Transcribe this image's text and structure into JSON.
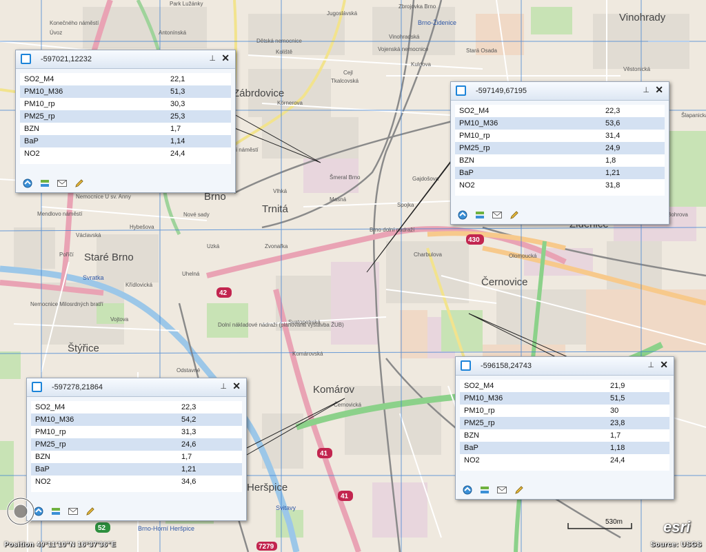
{
  "map": {
    "districts": [
      "Vinohrady",
      "Brno",
      "Trnitá",
      "Staré Brno",
      "Černovice",
      "Štýřice",
      "Komárov",
      "Heršpice",
      "Zábrdovice",
      "Židenice"
    ],
    "streets": [
      "Zbrojovka Brno",
      "Brno-Židenice",
      "Jugoslávská",
      "Dětská nemocnice",
      "Vojenská nemocnice",
      "Koliště",
      "Nemocnice U sv. Anny",
      "Mendlovo náměstí",
      "Hybešova",
      "Václavská",
      "Poříčí",
      "Křídlovická",
      "Nemocnice Milosrdných bratří",
      "Vojtova",
      "Úvoz",
      "Konečného náměstí",
      "Antonínská",
      "Park Lužánky",
      "Cejl",
      "Tkalcovská",
      "Körnerova",
      "Vlhká",
      "Masná",
      "Zvonařka",
      "Uzká",
      "Nové sady",
      "Uhelná",
      "Dolní nákladové nádraží (plánovaná výstavba ŽUB)",
      "Svatopetrská",
      "Komárovská",
      "Odstavné",
      "Černovická",
      "Charbulova",
      "Olomoucká",
      "Svratka",
      "Gajdošova",
      "Stará Osada",
      "Kuldova",
      "Vinohradská",
      "Věstonická",
      "Svitavy",
      "Brno-Horní Heršpice",
      "Bohrova",
      "Šlapanicka",
      "Spojka",
      "Brno dolní nádraží",
      "Šmeral Brno",
      "Sklámi náměstí"
    ],
    "shields": [
      "42",
      "430",
      "41",
      "41",
      "52",
      "7279"
    ]
  },
  "popups": [
    {
      "title": "-597021,12232",
      "rows": [
        {
          "key": "SO2_M4",
          "value": "22,1"
        },
        {
          "key": "PM10_M36",
          "value": "51,3"
        },
        {
          "key": "PM10_rp",
          "value": "30,3"
        },
        {
          "key": "PM25_rp",
          "value": "25,3"
        },
        {
          "key": "BZN",
          "value": "1,7"
        },
        {
          "key": "BaP",
          "value": "1,14"
        },
        {
          "key": "NO2",
          "value": "24,4"
        }
      ]
    },
    {
      "title": "-597149,67195",
      "rows": [
        {
          "key": "SO2_M4",
          "value": "22,3"
        },
        {
          "key": "PM10_M36",
          "value": "53,6"
        },
        {
          "key": "PM10_rp",
          "value": "31,4"
        },
        {
          "key": "PM25_rp",
          "value": "24,9"
        },
        {
          "key": "BZN",
          "value": "1,8"
        },
        {
          "key": "BaP",
          "value": "1,21"
        },
        {
          "key": "NO2",
          "value": "31,8"
        }
      ]
    },
    {
      "title": "-597278,21864",
      "rows": [
        {
          "key": "SO2_M4",
          "value": "22,3"
        },
        {
          "key": "PM10_M36",
          "value": "54,2"
        },
        {
          "key": "PM10_rp",
          "value": "31,3"
        },
        {
          "key": "PM25_rp",
          "value": "24,6"
        },
        {
          "key": "BZN",
          "value": "1,7"
        },
        {
          "key": "BaP",
          "value": "1,21"
        },
        {
          "key": "NO2",
          "value": "34,6"
        }
      ]
    },
    {
      "title": "-596158,24743",
      "rows": [
        {
          "key": "SO2_M4",
          "value": "21,9"
        },
        {
          "key": "PM10_M36",
          "value": "51,5"
        },
        {
          "key": "PM10_rp",
          "value": "30"
        },
        {
          "key": "PM25_rp",
          "value": "23,8"
        },
        {
          "key": "BZN",
          "value": "1,7"
        },
        {
          "key": "BaP",
          "value": "1,18"
        },
        {
          "key": "NO2",
          "value": "24,4"
        }
      ]
    }
  ],
  "popup_controls": {
    "pin": "⊥",
    "close": "✕"
  },
  "popup_tools": [
    "zoom-to-icon",
    "layers-icon",
    "email-icon",
    "pencil-icon"
  ],
  "scale_bar": {
    "label": "530m"
  },
  "logo": "esri",
  "footer": {
    "position": "Position 49°11'10\"N  16°37'36\"E",
    "source": "Source: USGS"
  },
  "colors": {
    "accent": "#1c84d9",
    "row_alt": "#d4e1f2",
    "grid": "#3a7fd4",
    "railway": "#888888",
    "major_road": "#e9a3b4",
    "river": "#9cc7e8"
  }
}
